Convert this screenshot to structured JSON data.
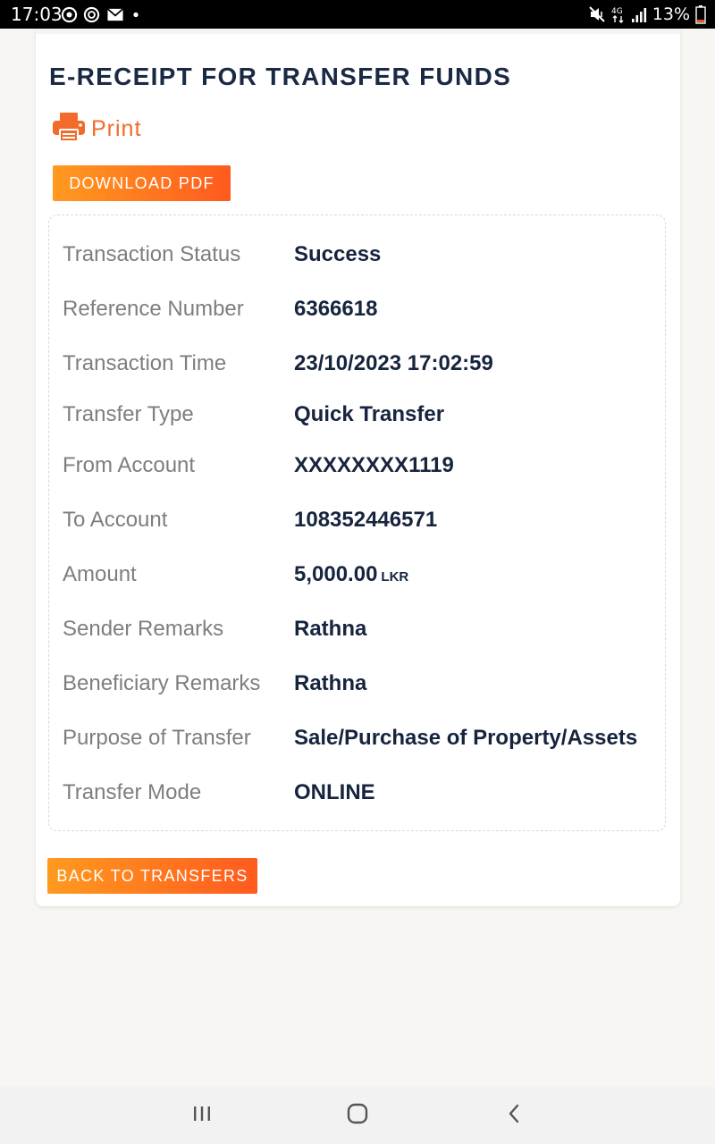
{
  "status_bar": {
    "time": "17:03",
    "battery": "13%",
    "icons": [
      "whatsapp-icon",
      "whatsapp-business-icon",
      "email-icon",
      "dot-icon",
      "mute-icon",
      "4g-icon",
      "signal-icon",
      "battery-icon"
    ]
  },
  "receipt": {
    "title": "E-RECEIPT FOR TRANSFER FUNDS",
    "print_label": "Print",
    "print_icon": "printer-icon",
    "download_label": "DOWNLOAD PDF",
    "back_label": "BACK TO TRANSFERS",
    "details": [
      {
        "label": "Transaction Status",
        "value": "Success"
      },
      {
        "label": "Reference Number",
        "value": "6366618"
      },
      {
        "label": "Transaction Time",
        "value": "23/10/2023 17:02:59"
      },
      {
        "label": "Transfer Type",
        "value": "Quick Transfer"
      },
      {
        "label": "From Account",
        "value": "XXXXXXXX1119"
      },
      {
        "label": "To Account",
        "value": "108352446571"
      },
      {
        "label": "Amount",
        "value": "5,000.00",
        "unit": "LKR"
      },
      {
        "label": "Sender Remarks",
        "value": "Rathna"
      },
      {
        "label": "Beneficiary Remarks",
        "value": "Rathna"
      },
      {
        "label": "Purpose of Transfer",
        "value": "Sale/Purchase of Property/Assets"
      },
      {
        "label": "Transfer Mode",
        "value": "ONLINE"
      }
    ]
  },
  "colors": {
    "accent": "#f26b2a",
    "button_gradient_start": "#ff9a1f",
    "button_gradient_end": "#ff5a1f",
    "title": "#1b2a44",
    "label": "#7e7e7e",
    "value": "#16243e"
  },
  "nav_bar": {
    "buttons": [
      "recents-icon",
      "home-icon",
      "back-icon"
    ]
  }
}
